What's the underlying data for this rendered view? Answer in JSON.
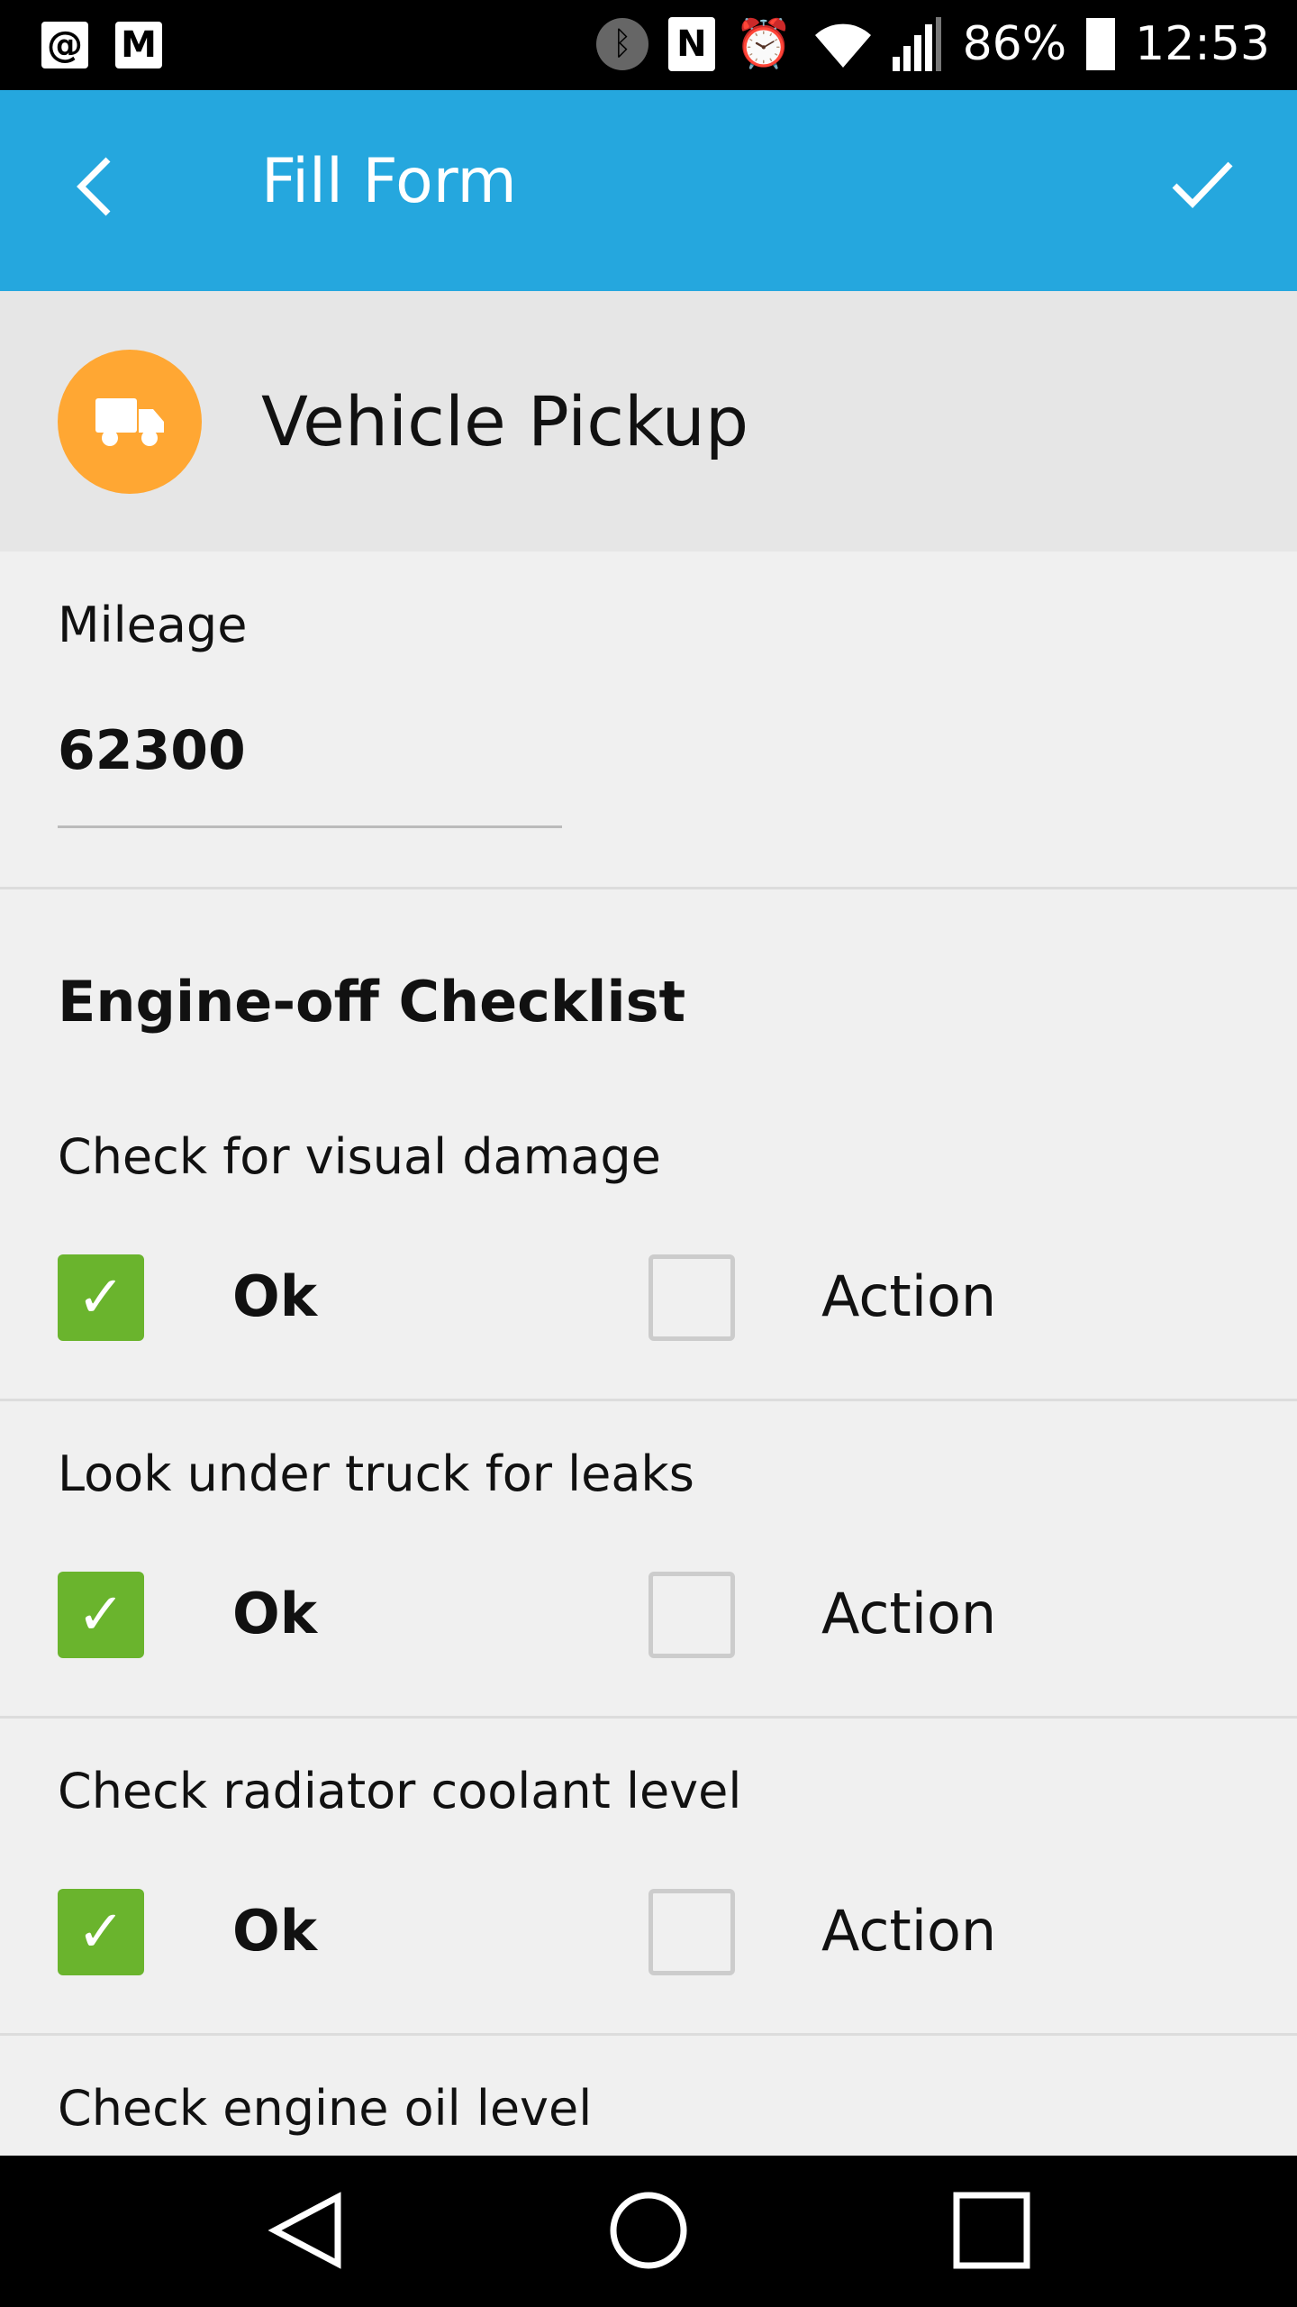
{
  "status_bar": {
    "battery": "86%",
    "time": "12:53",
    "left_icons": [
      "at-sign-icon",
      "gmail-icon"
    ],
    "right_icons": [
      "bluetooth-icon",
      "nfc-icon",
      "alarm-icon",
      "wifi-icon",
      "signal-icon",
      "battery-icon"
    ]
  },
  "app_bar": {
    "title": "Fill Form",
    "back_icon": "chevron-left-icon",
    "confirm_icon": "check-icon",
    "color": "#25a7de"
  },
  "form_header": {
    "title": "Vehicle Pickup",
    "icon": "truck-icon",
    "icon_color": "#ffa733"
  },
  "mileage": {
    "label": "Mileage",
    "value": "62300"
  },
  "section": {
    "title": "Engine-off Checklist"
  },
  "items": [
    {
      "label": "Check for visual damage",
      "ok_label": "Ok",
      "action_label": "Action",
      "ok_checked": true,
      "action_checked": false
    },
    {
      "label": "Look under truck for leaks",
      "ok_label": "Ok",
      "action_label": "Action",
      "ok_checked": true,
      "action_checked": false
    },
    {
      "label": "Check radiator coolant level",
      "ok_label": "Ok",
      "action_label": "Action",
      "ok_checked": true,
      "action_checked": false
    },
    {
      "label": "Check engine oil level"
    }
  ],
  "check_color": "#6ab42d"
}
